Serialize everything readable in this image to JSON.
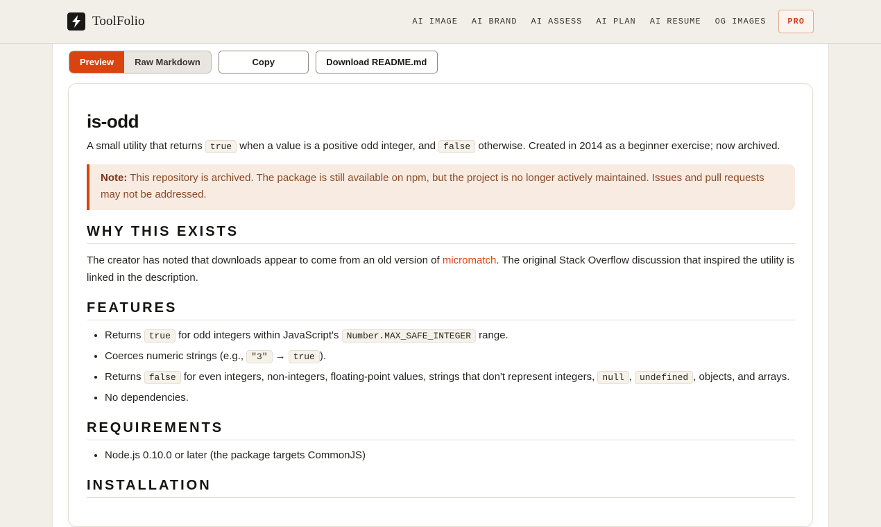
{
  "header": {
    "brand": "ToolFolio",
    "nav": [
      "AI IMAGE",
      "AI BRAND",
      "AI ASSESS",
      "AI PLAN",
      "AI RESUME",
      "OG IMAGES"
    ],
    "pro_label": "PRO"
  },
  "toolbar": {
    "preview_label": "Preview",
    "raw_label": "Raw Markdown",
    "copy_label": "Copy",
    "download_label": "Download README.md"
  },
  "readme": {
    "title": "is-odd",
    "lead": {
      "t1": "A small utility that returns ",
      "c1": "true",
      "t2": " when a value is a positive odd integer, and ",
      "c2": "false",
      "t3": " otherwise. Created in 2014 as a beginner exercise; now archived."
    },
    "note": {
      "label": "Note:",
      "text": " This repository is archived. The package is still available on npm, but the project is no longer actively maintained. Issues and pull requests may not be addressed."
    },
    "why": {
      "heading": "WHY THIS EXISTS",
      "t1": "The creator has noted that downloads appear to come from an old version of ",
      "link": "micromatch",
      "t2": ". The original Stack Overflow discussion that inspired the utility is linked in the description."
    },
    "features": {
      "heading": "FEATURES",
      "f1": {
        "t1": "Returns ",
        "c1": "true",
        "t2": " for odd integers within JavaScript's ",
        "c2": "Number.MAX_SAFE_INTEGER",
        "t3": " range."
      },
      "f2": {
        "t1": "Coerces numeric strings (e.g., ",
        "c1": "\"3\"",
        "arrow": "→",
        "c2": "true",
        "t2": ")."
      },
      "f3": {
        "t1": "Returns ",
        "c1": "false",
        "t2": " for even integers, non-integers, floating-point values, strings that don't represent integers, ",
        "c2": "null",
        "t3": ", ",
        "c3": "undefined",
        "t4": ", objects, and arrays."
      },
      "f4": "No dependencies."
    },
    "requirements": {
      "heading": "REQUIREMENTS",
      "r1": "Node.js 0.10.0 or later (the package targets CommonJS)"
    },
    "installation": {
      "heading": "INSTALLATION"
    }
  }
}
